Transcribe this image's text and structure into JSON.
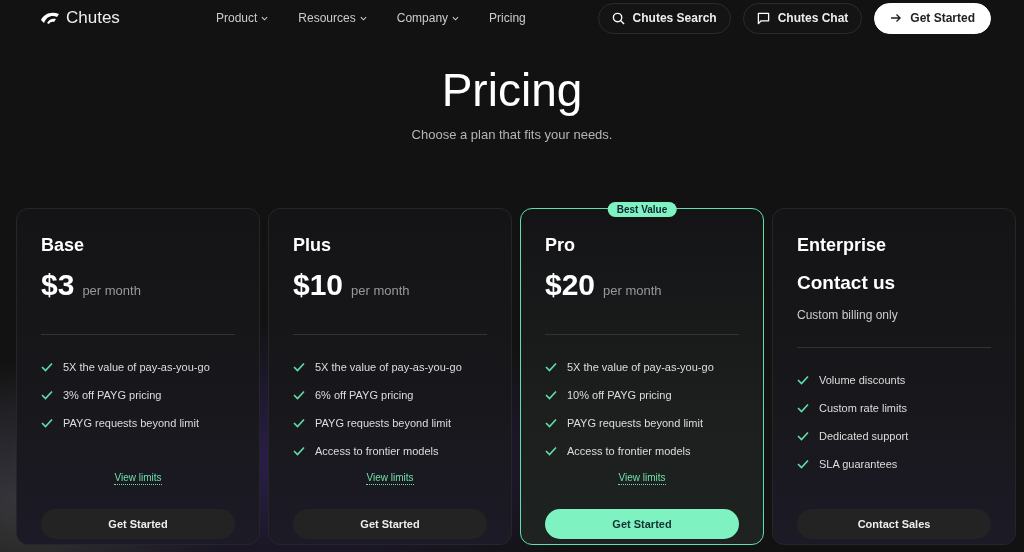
{
  "brand": {
    "name": "Chutes"
  },
  "nav": [
    {
      "label": "Product",
      "dropdown": true
    },
    {
      "label": "Resources",
      "dropdown": true
    },
    {
      "label": "Company",
      "dropdown": true
    },
    {
      "label": "Pricing",
      "dropdown": false
    }
  ],
  "header_buttons": [
    {
      "kind": "search",
      "label": "Chutes Search"
    },
    {
      "kind": "chat",
      "label": "Chutes Chat"
    },
    {
      "kind": "primary",
      "label": "Get Started"
    }
  ],
  "title": "Pricing",
  "subtitle": "Choose a plan that fits your needs.",
  "plans": [
    {
      "kind": "price",
      "name": "Base",
      "price": "$3",
      "period": "per month",
      "featured": false,
      "features": [
        "5X the value of pay-as-you-go",
        "3% off PAYG pricing",
        "PAYG requests beyond limit"
      ],
      "link": "View limits",
      "button": "Get Started"
    },
    {
      "kind": "price",
      "name": "Plus",
      "price": "$10",
      "period": "per month",
      "featured": false,
      "features": [
        "5X the value of pay-as-you-go",
        "6% off PAYG pricing",
        "PAYG requests beyond limit",
        "Access to frontier models"
      ],
      "link": "View limits",
      "button": "Get Started"
    },
    {
      "kind": "price",
      "name": "Pro",
      "price": "$20",
      "period": "per month",
      "featured": true,
      "badge": "Best Value",
      "features": [
        "5X the value of pay-as-you-go",
        "10% off PAYG pricing",
        "PAYG requests beyond limit",
        "Access to frontier models"
      ],
      "link": "View limits",
      "button": "Get Started"
    },
    {
      "kind": "contact",
      "name": "Enterprise",
      "heading": "Contact us",
      "note": "Custom billing only",
      "featured": false,
      "features": [
        "Volume discounts",
        "Custom rate limits",
        "Dedicated support",
        "SLA guarantees"
      ],
      "button": "Contact Sales"
    }
  ]
}
